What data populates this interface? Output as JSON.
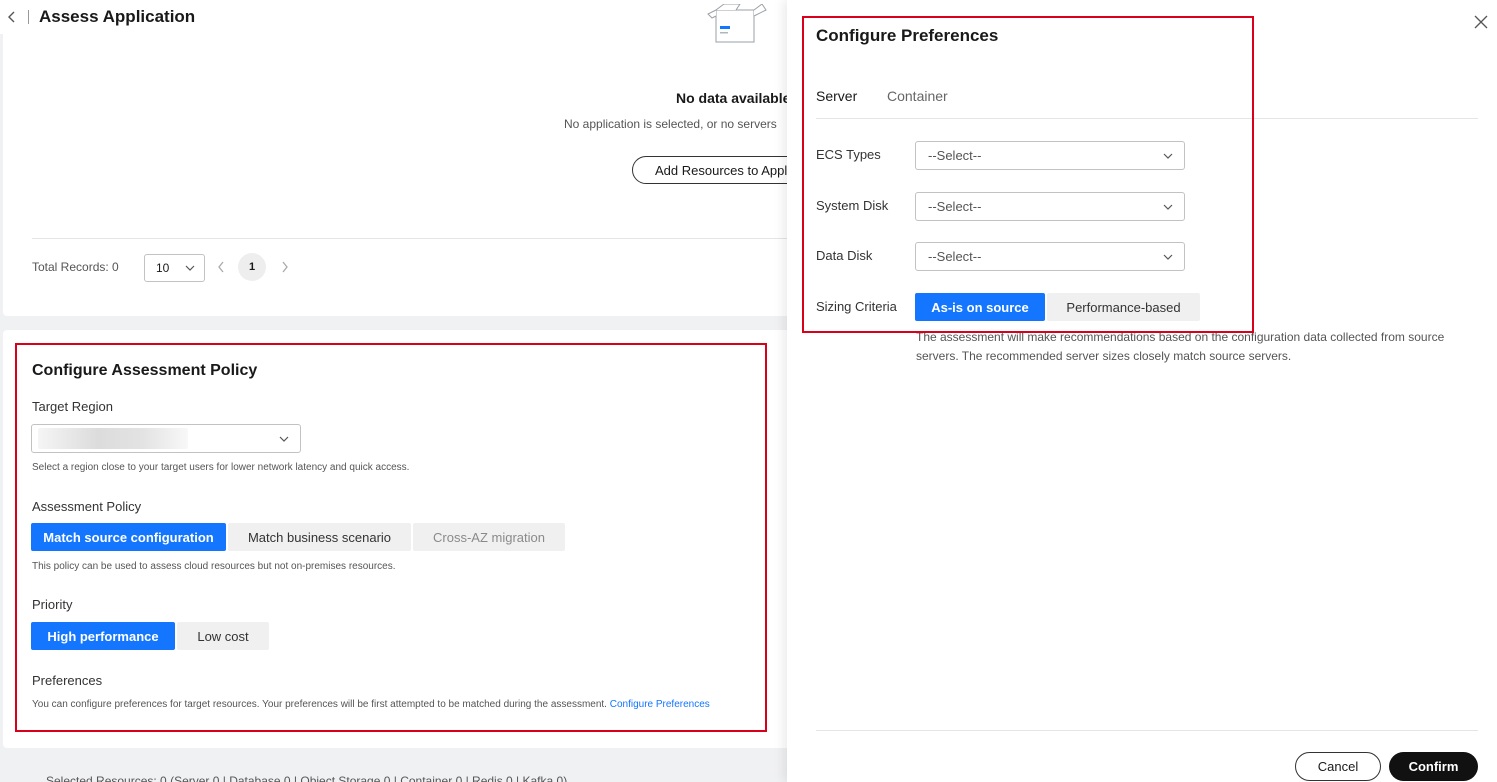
{
  "header": {
    "title": "Assess Application"
  },
  "resources": {
    "empty_title": "No data available",
    "empty_desc": "No application is selected, or no servers",
    "add_button": "Add Resources to Appli",
    "total_records": "Total Records: 0",
    "page_size": "10",
    "current_page": "1"
  },
  "policy": {
    "title": "Configure Assessment Policy",
    "target_region_label": "Target Region",
    "target_region_hint": "Select a region close to your target users for lower network latency and quick access.",
    "assessment_policy_label": "Assessment Policy",
    "assessment_options": [
      "Match source configuration",
      "Match business scenario",
      "Cross-AZ migration"
    ],
    "assessment_hint": "This policy can be used to assess cloud resources but not on-premises resources.",
    "priority_label": "Priority",
    "priority_options": [
      "High performance",
      "Low cost"
    ],
    "preferences_label": "Preferences",
    "preferences_hint": "You can configure preferences for target resources. Your preferences will be first attempted to be matched during the assessment.",
    "preferences_link": "Configure Preferences"
  },
  "footer": {
    "selected": "Selected Resources: 0 (Server 0 | Database 0 | Object Storage 0 | Container 0 | Redis 0 | Kafka 0)"
  },
  "drawer": {
    "title": "Configure Preferences",
    "tabs": [
      "Server",
      "Container"
    ],
    "ecs_label": "ECS Types",
    "ecs_value": "--Select--",
    "system_disk_label": "System Disk",
    "system_disk_value": "--Select--",
    "data_disk_label": "Data Disk",
    "data_disk_value": "--Select--",
    "sizing_label": "Sizing Criteria",
    "sizing_options": [
      "As-is on source",
      "Performance-based"
    ],
    "sizing_desc": "The assessment will make recommendations based on the configuration data collected from source servers. The recommended server sizes closely match source servers.",
    "cancel": "Cancel",
    "confirm": "Confirm"
  },
  "colors": {
    "accent": "#1476ff",
    "highlight_border": "#d9001b",
    "confirm_bg": "#111111"
  },
  "icons": [
    "back-icon",
    "empty-box-icon",
    "chevron-down-icon",
    "prev-page-icon",
    "next-page-icon",
    "close-icon"
  ]
}
